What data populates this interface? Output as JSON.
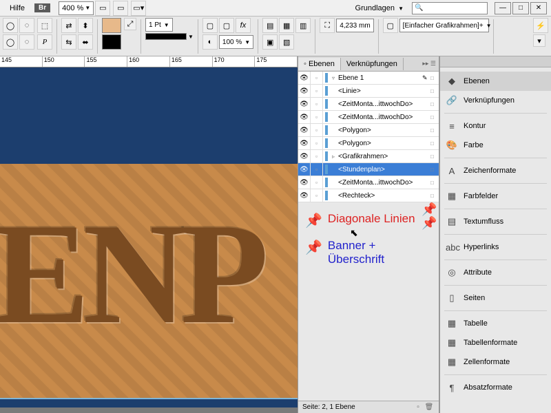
{
  "menubar": {
    "help": "Hilfe",
    "br": "Br",
    "zoom": "400 %",
    "workspace": "Grundlagen",
    "search_placeholder": ""
  },
  "toolbar": {
    "stroke_weight": "1 Pt",
    "percent": "100 %",
    "measure": "4,233 mm",
    "frame_fitting": "[Einfacher Grafikrahmen]+",
    "fx": "fx"
  },
  "ruler": {
    "t0": "145",
    "t1": "150",
    "t2": "155",
    "t3": "160",
    "t4": "165",
    "t5": "170",
    "t6": "175"
  },
  "canvas": {
    "big": "ENP"
  },
  "layers_panel": {
    "tab_layers": "Ebenen",
    "tab_links": "Verknüpfungen",
    "root": "Ebene 1",
    "items": [
      {
        "name": "<Linie>"
      },
      {
        "name": "<ZeitMonta...ittwochDo>"
      },
      {
        "name": "<ZeitMonta...ittwochDo>"
      },
      {
        "name": "<Polygon>"
      },
      {
        "name": "<Polygon>"
      },
      {
        "name": "<Grafikrahmen>"
      },
      {
        "name": "<Stundenplan>"
      },
      {
        "name": "<ZeitMonta...ittwochDo>"
      },
      {
        "name": "<Rechteck>"
      }
    ],
    "status": "Seite: 2, 1 Ebene"
  },
  "annotations": {
    "red": "Diagonale Linien",
    "blue": "Banner + Überschrift"
  },
  "right_panel": {
    "items": [
      {
        "icon": "◆",
        "label": "Ebenen",
        "active": true
      },
      {
        "icon": "🔗",
        "label": "Verknüpfungen"
      },
      {
        "sep": true
      },
      {
        "icon": "≡",
        "label": "Kontur"
      },
      {
        "icon": "🎨",
        "label": "Farbe"
      },
      {
        "sep": true
      },
      {
        "icon": "A",
        "label": "Zeichenformate"
      },
      {
        "sep": true
      },
      {
        "icon": "▦",
        "label": "Farbfelder"
      },
      {
        "sep": true
      },
      {
        "icon": "▤",
        "label": "Textumfluss"
      },
      {
        "sep": true
      },
      {
        "icon": "abc",
        "label": "Hyperlinks"
      },
      {
        "sep": true
      },
      {
        "icon": "◎",
        "label": "Attribute"
      },
      {
        "sep": true
      },
      {
        "icon": "▯",
        "label": "Seiten"
      },
      {
        "sep": true
      },
      {
        "icon": "▦",
        "label": "Tabelle"
      },
      {
        "icon": "▦",
        "label": "Tabellenformate"
      },
      {
        "icon": "▦",
        "label": "Zellenformate"
      },
      {
        "sep": true
      },
      {
        "icon": "¶",
        "label": "Absatzformate"
      }
    ]
  }
}
